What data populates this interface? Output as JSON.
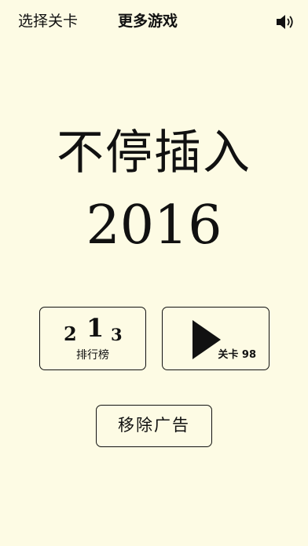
{
  "topbar": {
    "select_level_label": "选择关卡",
    "more_games_label": "更多游戏",
    "sound_icon": "speaker-volume-icon"
  },
  "title": {
    "line1": "不停插入",
    "line2": "2016"
  },
  "leaderboard_button": {
    "first": "1",
    "second": "2",
    "third": "3",
    "label": "排行榜"
  },
  "play_button": {
    "icon": "play-icon",
    "level_label": "关卡 98"
  },
  "remove_ads_button": {
    "label": "移除广告"
  },
  "colors": {
    "background": "#fdfbe4",
    "foreground": "#111111"
  }
}
